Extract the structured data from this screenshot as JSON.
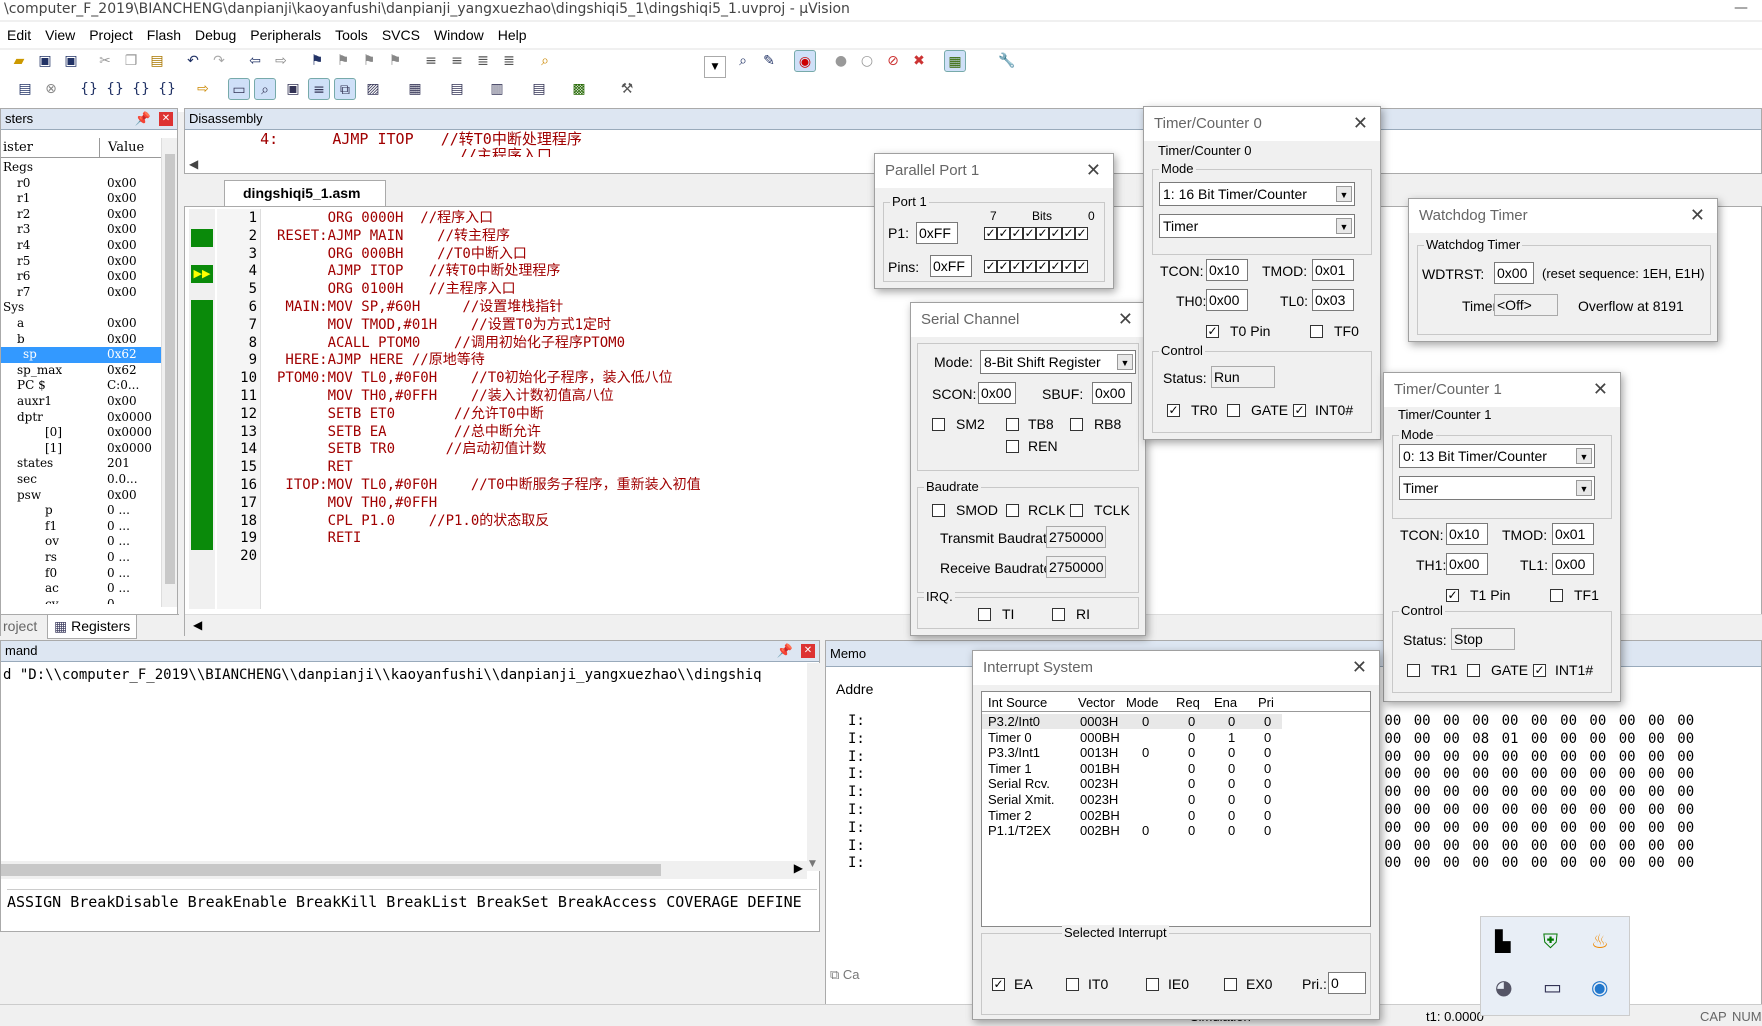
{
  "window": {
    "title": "\\computer_F_2019\\BIANCHENG\\danpianji\\kaoyanfushi\\danpianji_yangxuezhao\\dingshiqi5_1\\dingshiqi5_1.uvproj - µVision",
    "min": "—"
  },
  "menu": [
    "Edit",
    "View",
    "Project",
    "Flash",
    "Debug",
    "Peripherals",
    "Tools",
    "SVCS",
    "Window",
    "Help"
  ],
  "registers": {
    "header": "sters",
    "col_register": "ister",
    "col_value": "Value",
    "tabs": [
      "roject",
      "Registers"
    ],
    "rows": [
      {
        "name": "Regs",
        "value": ""
      },
      {
        "name": "r0",
        "value": "0x00"
      },
      {
        "name": "r1",
        "value": "0x00"
      },
      {
        "name": "r2",
        "value": "0x00"
      },
      {
        "name": "r3",
        "value": "0x00"
      },
      {
        "name": "r4",
        "value": "0x00"
      },
      {
        "name": "r5",
        "value": "0x00"
      },
      {
        "name": "r6",
        "value": "0x00"
      },
      {
        "name": "r7",
        "value": "0x00"
      },
      {
        "name": "Sys",
        "value": ""
      },
      {
        "name": "a",
        "value": "0x00"
      },
      {
        "name": "b",
        "value": "0x00"
      },
      {
        "name": "sp",
        "value": "0x62"
      },
      {
        "name": "sp_max",
        "value": "0x62"
      },
      {
        "name": "PC  $",
        "value": "C:0..."
      },
      {
        "name": "auxr1",
        "value": "0x00"
      },
      {
        "name": "dptr",
        "value": "0x0000"
      },
      {
        "name": "[0]",
        "value": "0x0000"
      },
      {
        "name": "[1]",
        "value": "0x0000"
      },
      {
        "name": "states",
        "value": "201"
      },
      {
        "name": "sec",
        "value": "0.0..."
      },
      {
        "name": "psw",
        "value": "0x00"
      },
      {
        "name": "p",
        "value": "0  ..."
      },
      {
        "name": "f1",
        "value": "0  ..."
      },
      {
        "name": "ov",
        "value": "0  ..."
      },
      {
        "name": "rs",
        "value": "0  ..."
      },
      {
        "name": "f0",
        "value": "0  ..."
      },
      {
        "name": "ac",
        "value": "0  ..."
      },
      {
        "name": "cy",
        "value": "0  ..."
      }
    ]
  },
  "disassembly": {
    "header": "Disassembly",
    "line1": "   4:      AJMP ITOP   //转T0中断处理程序",
    "line2": "                         //主程序入口"
  },
  "editor": {
    "tab": "dingshiqi5_1.asm",
    "lines": [
      "      ORG 0000H  //程序入口",
      "RESET:AJMP MAIN    //转主程序",
      "      ORG 000BH    //T0中断入口",
      "      AJMP ITOP   //转T0中断处理程序",
      "      ORG 0100H   //主程序入口",
      " MAIN:MOV SP,#60H     //设置堆栈指针",
      "      MOV TMOD,#01H    //设置T0为方式1定时",
      "      ACALL PTOM0    //调用初始化子程序PTOM0",
      " HERE:AJMP HERE //原地等待",
      "PTOM0:MOV TL0,#0F0H    //T0初始化子程序，装入低八位",
      "      MOV TH0,#0FFH    //装入计数初值高八位",
      "      SETB ET0       //允许T0中断",
      "      SETB EA        //总中断允许",
      "      SETB TR0      //启动初值计数",
      "      RET",
      " ITOP:MOV TL0,#0F0H    //T0中断服务子程序，重新装入初值",
      "      MOV TH0,#0FFH",
      "      CPL P1.0    //P1.0的状态取反",
      "      RETI",
      ""
    ]
  },
  "command": {
    "header": "mand",
    "line": "d \"D:\\\\computer_F_2019\\\\BIANCHENG\\\\danpianji\\\\kaoyanfushi\\\\danpianji_yangxuezhao\\\\dingshiq",
    "bottom": "ASSIGN BreakDisable BreakEnable BreakKill BreakList BreakSet BreakAccess COVERAGE DEFINE"
  },
  "memory": {
    "header": "Memo",
    "addr_label": "Addre",
    "prefix": "I:",
    "hex_rows": [
      "00 00 00 00 00 00 00 00 00 00 00 00 00 00 00 00",
      "00 00 00 00 00 00 00 00 08 01 00 00 00 00 00 00",
      "00 00 00 00 00 00 00 00 00 00 00 00 00 00 00 00",
      "00 00 00 00 00 00 00 00 00 00 00 00 00 00 00 00",
      "00 00 00 00 00 00 00 00 00 00 00 00 00 00 00 00",
      "00 00 00 00 00 00 00 00 00 00 00 00 00 00 00 00",
      "00 00 00 00 00 00 00 00 00 00 00 00 00 00 00 00",
      "00 00 00 00 00 00 00 00 00 00 00 00 00 00 00 00",
      "00 00 00 00 00 00 00 00 00 00 00 00 00 00 00 00"
    ],
    "tab": "Ca"
  },
  "status": {
    "sim": "Simulation",
    "t1": "t1: 0.0000",
    "cap": "CAP",
    "num": "NUM"
  },
  "parallel": {
    "title": "Parallel Port 1",
    "group": "Port 1",
    "p1_label": "P1:",
    "p1": "0xFF",
    "pins_label": "Pins:",
    "pins": "0xFF",
    "bit7": "7",
    "bits": "Bits",
    "bit0": "0"
  },
  "serial": {
    "title": "Serial Channel",
    "mode_label": "Mode:",
    "mode": "8-Bit Shift Register",
    "scon_label": "SCON:",
    "scon": "0x00",
    "sbuf_label": "SBUF:",
    "sbuf": "0x00",
    "sm2": "SM2",
    "tb8": "TB8",
    "rb8": "RB8",
    "ren": "REN",
    "baud_group": "Baudrate",
    "smod": "SMOD",
    "rclk": "RCLK",
    "tclk": "TCLK",
    "tx_label": "Transmit Baudrate:",
    "tx": "2750000",
    "rx_label": "Receive Baudrate:",
    "rx": "2750000",
    "irq_group": "IRQ.",
    "ti": "TI",
    "ri": "RI"
  },
  "timer0": {
    "title": "Timer/Counter 0",
    "group": "Timer/Counter 0",
    "mode_group": "Mode",
    "mode": "1: 16 Bit Timer/Counter",
    "type": "Timer",
    "tcon_label": "TCON:",
    "tcon": "0x10",
    "tmod_label": "TMOD:",
    "tmod": "0x01",
    "th_label": "TH0:",
    "th": "0x00",
    "tl_label": "TL0:",
    "tl": "0x03",
    "pin": "T0 Pin",
    "tf": "TF0",
    "control": "Control",
    "status_label": "Status:",
    "status": "Run",
    "tr": "TR0",
    "gate": "GATE",
    "int": "INT0#"
  },
  "watchdog": {
    "title": "Watchdog Timer",
    "group": "Watchdog Timer",
    "wdtrst_label": "WDTRST:",
    "wdtrst": "0x00",
    "reset_note": "(reset sequence: 1EH, E1H)",
    "timer_label": "Timer:",
    "timer": "<Off>",
    "overflow": "Overflow at 8191"
  },
  "timer1": {
    "title": "Timer/Counter 1",
    "group": "Timer/Counter 1",
    "mode_group": "Mode",
    "mode": "0: 13 Bit Timer/Counter",
    "type": "Timer",
    "tcon_label": "TCON:",
    "tcon": "0x10",
    "tmod_label": "TMOD:",
    "tmod": "0x01",
    "th_label": "TH1:",
    "th": "0x00",
    "tl_label": "TL1:",
    "tl": "0x00",
    "pin": "T1 Pin",
    "tf": "TF1",
    "control": "Control",
    "status_label": "Status:",
    "status": "Stop",
    "tr": "TR1",
    "gate": "GATE",
    "int": "INT1#"
  },
  "interrupt": {
    "title": "Interrupt System",
    "cols": [
      "Int Source",
      "Vector",
      "Mode",
      "Req",
      "Ena",
      "Pri"
    ],
    "rows": [
      [
        "P3.2/Int0",
        "0003H",
        "0",
        "0",
        "0",
        "0"
      ],
      [
        "Timer 0",
        "000BH",
        "",
        "0",
        "1",
        "0"
      ],
      [
        "P3.3/Int1",
        "0013H",
        "0",
        "0",
        "0",
        "0"
      ],
      [
        "Timer 1",
        "001BH",
        "",
        "0",
        "0",
        "0"
      ],
      [
        "Serial Rcv.",
        "0023H",
        "",
        "0",
        "0",
        "0"
      ],
      [
        "Serial Xmit.",
        "0023H",
        "",
        "0",
        "0",
        "0"
      ],
      [
        "Timer 2",
        "002BH",
        "",
        "0",
        "0",
        "0"
      ],
      [
        "P1.1/T2EX",
        "002BH",
        "0",
        "0",
        "0",
        "0"
      ]
    ],
    "selected": "Selected Interrupt",
    "ea": "EA",
    "it0": "IT0",
    "ie0": "IE0",
    "ex0": "EX0",
    "pri_label": "Pri.:",
    "pri": "0"
  }
}
